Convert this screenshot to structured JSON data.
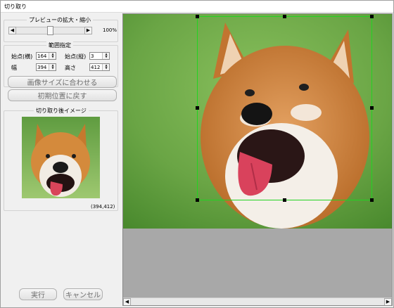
{
  "window": {
    "title": "切り取り"
  },
  "preview": {
    "group_title": "プレビューの拡大・縮小",
    "zoom_value": "100%",
    "zoom_fraction": 0.5
  },
  "range": {
    "group_title": "範囲指定",
    "start_x_label": "始点(横)",
    "start_x_value": "164",
    "start_y_label": "始点(縦)",
    "start_y_value": "3",
    "width_label": "幅",
    "width_value": "394",
    "height_label": "高さ",
    "height_value": "412"
  },
  "buttons": {
    "fit_image": "画像サイズに合わせる",
    "reset_position": "初期位置に戻す",
    "run": "実行",
    "cancel": "キャンセル"
  },
  "result": {
    "group_title": "切り取り後イメージ",
    "size_text": "(394,412)"
  },
  "icons": {
    "left": "arrow-left-icon",
    "right": "arrow-right-icon",
    "up": "arrow-up-icon",
    "down": "arrow-down-icon"
  },
  "colors": {
    "selection": "#22d322",
    "handle": "#000000",
    "canvas_bg": "#a8a8a8"
  }
}
